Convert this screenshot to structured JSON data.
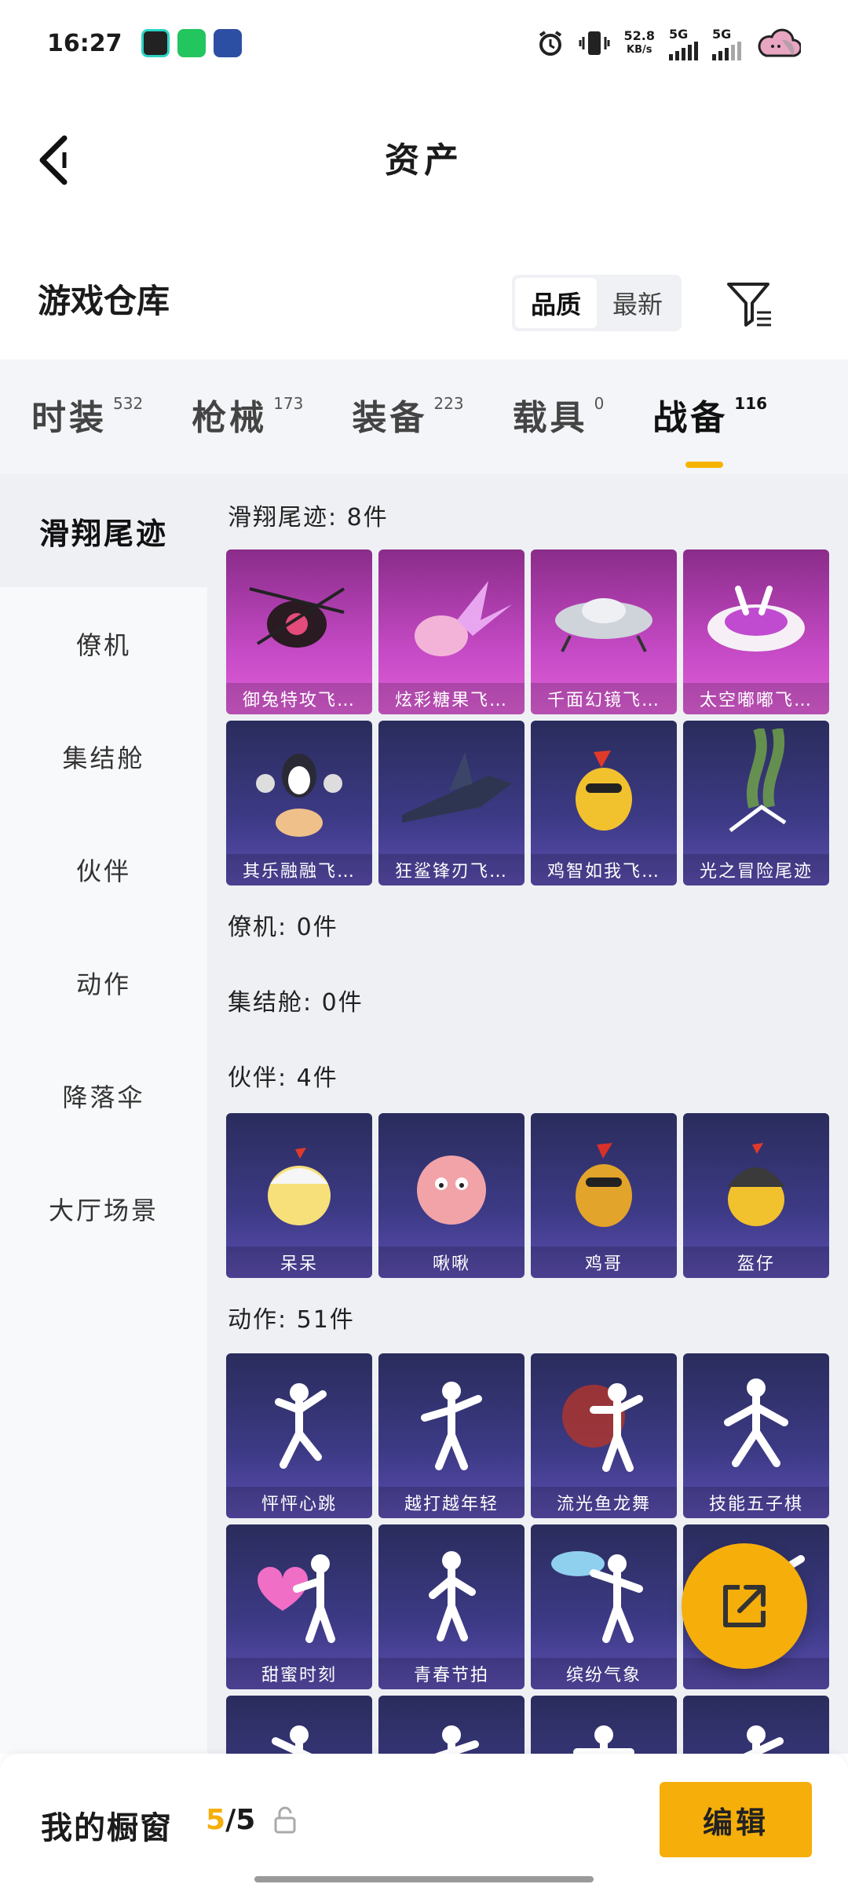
{
  "status_bar": {
    "time": "16:27",
    "net_speed": "52.8",
    "net_unit": "KB/s",
    "sim1": "5G",
    "sim2": "5G"
  },
  "header": {
    "title": "资产"
  },
  "warehouse": {
    "title": "游戏仓库",
    "sort": [
      "品质",
      "最新"
    ]
  },
  "tabs": [
    {
      "label": "时装",
      "count": "532"
    },
    {
      "label": "枪械",
      "count": "173"
    },
    {
      "label": "装备",
      "count": "223"
    },
    {
      "label": "载具",
      "count": "0"
    },
    {
      "label": "战备",
      "count": "116"
    }
  ],
  "side_nav": [
    "滑翔尾迹",
    "僚机",
    "集结舱",
    "伙伴",
    "动作",
    "降落伞",
    "大厅场景"
  ],
  "sections": {
    "glide": {
      "title": "滑翔尾迹: 8件",
      "items": [
        "御兔特攻飞…",
        "炫彩糖果飞…",
        "千面幻镜飞…",
        "太空嘟嘟飞…",
        "其乐融融飞…",
        "狂鲨锋刃飞…",
        "鸡智如我飞…",
        "光之冒险尾迹"
      ]
    },
    "wingman": {
      "title": "僚机: 0件"
    },
    "capsule": {
      "title": "集结舱: 0件"
    },
    "partner": {
      "title": "伙伴: 4件",
      "items": [
        "呆呆",
        "啾啾",
        "鸡哥",
        "盔仔"
      ]
    },
    "emote": {
      "title": "动作: 51件",
      "items": [
        "怦怦心跳",
        "越打越年轻",
        "流光鱼龙舞",
        "技能五子棋",
        "甜蜜时刻",
        "青春节拍",
        "缤纷气象",
        ""
      ]
    }
  },
  "bottom": {
    "showcase_label": "我的橱窗",
    "count_current": "5",
    "count_total": "/5",
    "edit": "编辑"
  },
  "colors": {
    "accent": "#f5ae0a",
    "rare_card": "#c449c4",
    "common_card": "#3d3a86"
  }
}
